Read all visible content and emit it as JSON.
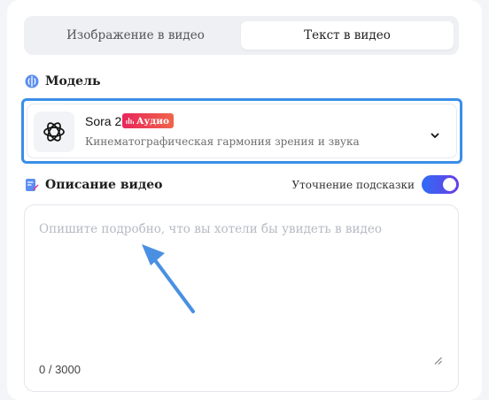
{
  "tabs": [
    {
      "label": "Изображение в видео",
      "active": false
    },
    {
      "label": "Текст в видео",
      "active": true
    }
  ],
  "model_section": {
    "title": "Модель",
    "selected_model": {
      "name": "Sora 2",
      "badge": "Аудио",
      "description": "Кинематографическая гармония зрения и звука",
      "logo": "openai-logo-icon"
    }
  },
  "description_section": {
    "title": "Описание видео",
    "prompt_refine_label": "Уточнение подсказки",
    "prompt_refine_enabled": true,
    "placeholder": "Опишите подробно, что вы хотели бы увидеть в видео",
    "counter": "0 / 3000"
  },
  "colors": {
    "highlight_border": "#3a8ee8",
    "badge_gradient": [
      "#e8265b",
      "#f0644a"
    ],
    "toggle_gradient": [
      "#2f6cf5",
      "#6a3de6"
    ],
    "annotation_arrow": "#4a90e2"
  }
}
